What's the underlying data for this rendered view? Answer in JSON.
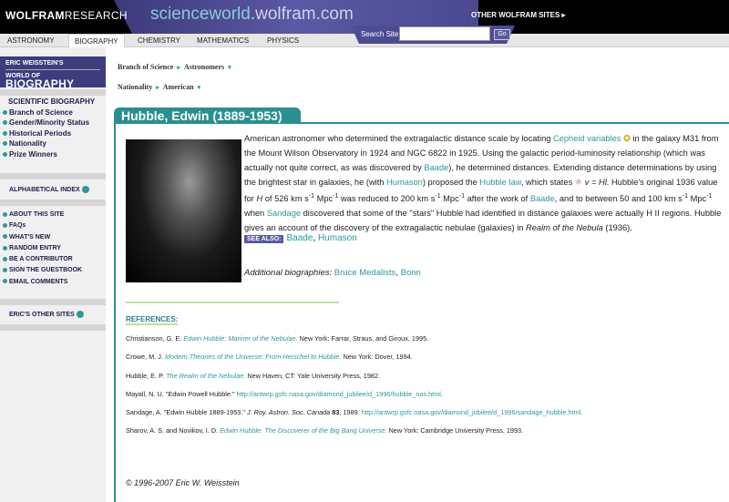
{
  "header": {
    "logo_bold": "WOLFRAM",
    "logo_light": "RESEARCH",
    "site_a": "scienceworld",
    "site_b": ".wolfram.com",
    "other_sites": "OTHER WOLFRAM SITES ▸",
    "search_label": "Search Site",
    "search_value": "",
    "go": "Go"
  },
  "tabs": [
    "ASTRONOMY",
    "BIOGRAPHY",
    "CHEMISTRY",
    "MATHEMATICS",
    "PHYSICS"
  ],
  "brand": {
    "line1": "ERIC WEISSTEIN'S",
    "line2a": "WORLD OF ",
    "line2b": "BIOGRAPHY"
  },
  "sidebar": {
    "section": "SCIENTIFIC BIOGRAPHY",
    "items": [
      "Branch of Science",
      "Gender/Minority Status",
      "Historical Periods",
      "Nationality",
      "Prize Winners"
    ],
    "alpha": "ALPHABETICAL INDEX",
    "site_items": [
      "ABOUT THIS SITE",
      "FAQs",
      "WHAT'S NEW",
      "RANDOM ENTRY",
      "BE A CONTRIBUTOR",
      "SIGN THE GUESTBOOK",
      "EMAIL COMMENTS"
    ],
    "other": "ERIC'S OTHER SITES"
  },
  "breadcrumbs": [
    {
      "label": "Branch of Science",
      "value": "Astronomers"
    },
    {
      "label": "Nationality",
      "value": "American"
    }
  ],
  "title": "Hubble, Edwin (1889-1953)",
  "bio": {
    "p1": "American astronomer who determined the extragalactic distance scale by locating ",
    "l1": "Cepheid variables",
    "p2": " in the galaxy M31 from the Mount Wilson Observatory in 1924 and NGC 6822 in 1925. Using the galactic period-luminosity relationship (which was actually not quite correct, as was discovered by ",
    "l2": "Baade",
    "p3": "), he determined distances. Extending distance determinations by using the brightest star in galaxies, he (with ",
    "l3": "Humason",
    "p4": ") proposed the ",
    "l4": "Hubble law",
    "p5": ", which states ",
    "eq": "v = Hl",
    "p6": ". Hubble's original 1936 value for ",
    "h": "H",
    "p7": " of 526 km s",
    "u1": "-1",
    "p8": " Mpc",
    "u2": "-1",
    "p9": " was reduced to 200 km s",
    "u3": "-1",
    "p10": " Mpc",
    "u4": "-1",
    "p11": " after the work of ",
    "l5": "Baade",
    "p12": ", and to between 50 and 100 km s",
    "u5": "-1",
    "p13": " Mpc",
    "u6": "-1",
    "p14": " when ",
    "l6": "Sandage",
    "p15": " discovered that some of the \"stars\" Hubble had identified in distance galaxies were actually H II regions. Hubble gives an account of the discovery of the extragalactic nebulae (galaxies) in ",
    "book": "Realm of the Nebula",
    "p16": " (1936)."
  },
  "see_also": {
    "label": "SEE ALSO:",
    "links": [
      "Baade",
      "Humason"
    ]
  },
  "additional": {
    "label": "Additional biographies:",
    "links": [
      "Bruce Medalists",
      "Bonn"
    ]
  },
  "references": {
    "heading": "REFERENCES:",
    "items": [
      {
        "pre": "Christianson, G. E. ",
        "title": "Edwin Hubble: Mariner of the Nebulae.",
        "post": " New York: Farrar, Straus, and Giroux, 1995."
      },
      {
        "pre": "Crowe, M. J. ",
        "title": "Modern Theories of the Universe: From Herschel to Hubble.",
        "post": " New York: Dover, 1994."
      },
      {
        "pre": "Hubble, E. P. ",
        "title": "The Realm of the Nebulae.",
        "post": " New Haven, CT: Yale University Press, 1982."
      },
      {
        "pre": "Mayall, N. U. \"Edwin Powell Hubble.\" ",
        "url": "http://antwrp.gsfc.nasa.gov/diamond_jubilee/d_1996/hubble_nas.html",
        "post": "."
      },
      {
        "pre": "Sandage, A. \"Edwin Hubble 1889-1953.\" ",
        "journal": "J. Roy. Astron. Soc. Canada",
        "vol": "83",
        "mid": ", 1989. ",
        "url": "http://antwrp.gsfc.nasa.gov/diamond_jubilee/d_1996/sandage_hubble.html",
        "post": "."
      },
      {
        "pre": "Sharov, A. S. and Novikov, I. D. ",
        "title": "Edwin Hubble: The Discoverer of the Big Bang Universe.",
        "post": " New York: Cambridge University Press, 1993."
      }
    ]
  },
  "copyright": "© 1996-2007 Eric W. Weisstein"
}
